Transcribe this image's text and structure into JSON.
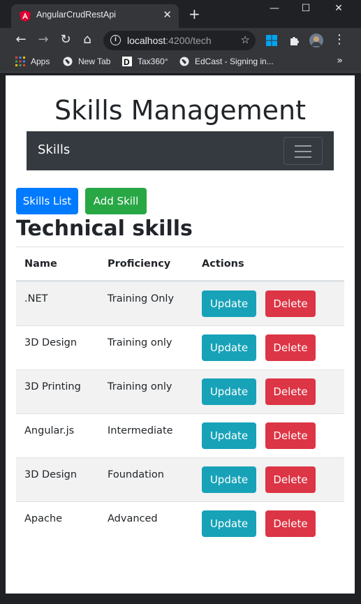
{
  "browser": {
    "tab_title": "AngularCrudRestApi",
    "tab_close": "✕",
    "new_tab": "+",
    "window_controls": {
      "minimize": "—",
      "maximize": "☐",
      "close": "✕"
    },
    "nav": {
      "back": "←",
      "forward": "→",
      "reload": "↻",
      "home": "⌂"
    },
    "address": {
      "host": "localhost",
      "path": ":4200/tech",
      "info": "i",
      "star": "☆"
    },
    "menu": "⋮",
    "bookmarks": [
      {
        "label": "Apps",
        "icon": "apps-grid-icon"
      },
      {
        "label": "New Tab",
        "icon": "globe-icon"
      },
      {
        "label": "Tax360°",
        "icon": "d-logo-icon"
      },
      {
        "label": "EdCast - Signing in...",
        "icon": "globe-icon"
      }
    ],
    "bookmarks_more": "»",
    "colors": {
      "chrome_dark": "#202124",
      "chrome_toolbar": "#35363a",
      "angular_red": "#dd0031"
    }
  },
  "page": {
    "title": "Skills Management",
    "navbar": {
      "brand": "Skills"
    },
    "buttons": {
      "skills_list": "Skills List",
      "add_skill": "Add Skill"
    },
    "section_heading": "Technical skills",
    "table": {
      "headers": [
        "Name",
        "Proficiency",
        "Actions"
      ],
      "rows": [
        {
          "name": ".NET",
          "proficiency": "Training Only",
          "update": "Update",
          "delete": "Delete"
        },
        {
          "name": "3D Design",
          "proficiency": "Training only",
          "update": "Update",
          "delete": "Delete"
        },
        {
          "name": "3D Printing",
          "proficiency": "Training only",
          "update": "Update",
          "delete": "Delete"
        },
        {
          "name": "Angular.js",
          "proficiency": "Intermediate",
          "update": "Update",
          "delete": "Delete"
        },
        {
          "name": "3D Design",
          "proficiency": "Foundation",
          "update": "Update",
          "delete": "Delete"
        },
        {
          "name": "Apache",
          "proficiency": "Advanced",
          "update": "Update",
          "delete": "Delete"
        }
      ]
    },
    "colors": {
      "primary": "#007bff",
      "success": "#28a745",
      "info": "#17a2b8",
      "danger": "#dc3545",
      "navbar": "#343a40"
    }
  }
}
